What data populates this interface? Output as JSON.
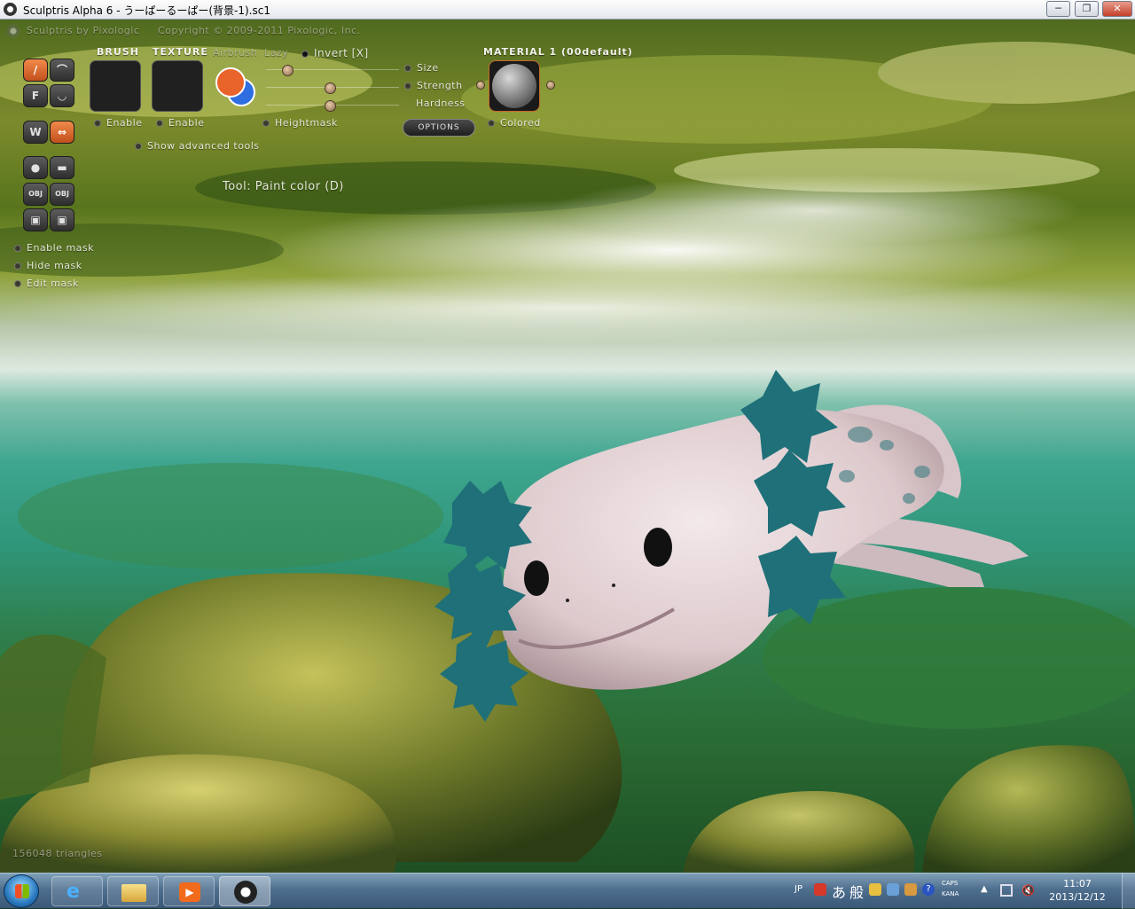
{
  "window": {
    "title": "Sculptris Alpha 6 - うーぱーるーぱー(背景-1).sc1",
    "min_label": "─",
    "max_label": "❐",
    "close_label": "✕"
  },
  "header": {
    "brand": "Sculptris by Pixologic",
    "copyright": "Copyright © 2009-2011 Pixologic, Inc."
  },
  "toolbar": {
    "brush_label": "BRUSH",
    "texture_label": "TEXTURE",
    "airbrush_label": "Airbrush",
    "lazy_label": "Lazy",
    "invert_label": "Invert [X]",
    "size_label": "Size",
    "strength_label": "Strength",
    "hardness_label": "Hardness",
    "brush_enable": "Enable",
    "texture_enable": "Enable",
    "heightmask_label": "Heightmask",
    "options_label": "OPTIONS",
    "material_label": "MATERIAL 1 (00default)",
    "colored_label": "Colored",
    "advanced_label": "Show advanced tools",
    "tool_status": "Tool: Paint color (D)",
    "primary_color": "#e8642a",
    "secondary_color": "#2e6ee0",
    "accent_color": "#d8642a"
  },
  "tools": {
    "paint_icon": "brush-icon",
    "flatten_label": "F",
    "obj_label_1": "OBJ",
    "obj_label_2": "OBJ",
    "symmetry_icon": "arrows-horizontal-icon"
  },
  "mask": {
    "enable_label": "Enable mask",
    "hide_label": "Hide mask",
    "edit_label": "Edit mask"
  },
  "status": {
    "triangles": "156048 triangles"
  },
  "taskbar": {
    "lang": "JP",
    "ime_a": "あ",
    "ime_b": "般",
    "caps": "CAPS",
    "kana": "KANA",
    "time": "11:07",
    "date": "2013/12/12"
  }
}
